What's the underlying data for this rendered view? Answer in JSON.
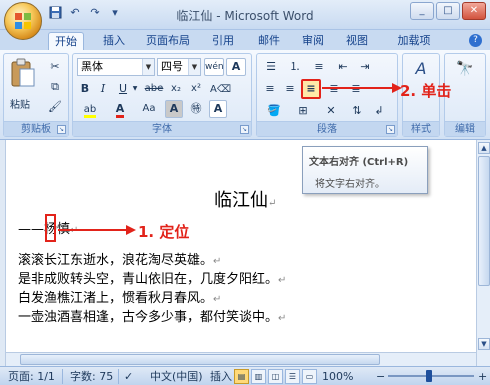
{
  "titlebar": {
    "title": "临江仙 - Microsoft Word",
    "qat": [
      "save-icon",
      "undo-icon",
      "redo-icon",
      "customize-icon"
    ],
    "window_buttons": [
      "_",
      "□",
      "✕"
    ]
  },
  "tabs": [
    {
      "label": "开始",
      "active": true
    },
    {
      "label": "插入"
    },
    {
      "label": "页面布局"
    },
    {
      "label": "引用"
    },
    {
      "label": "邮件"
    },
    {
      "label": "审阅"
    },
    {
      "label": "视图"
    },
    {
      "label": "加载项"
    }
  ],
  "ribbon": {
    "clipboard": {
      "label": "剪贴板",
      "paste_label": "粘贴"
    },
    "font": {
      "label": "字体",
      "font_name": "黑体",
      "font_size": "四号",
      "btn_wen": "wén",
      "btn_A": "A",
      "bold": "B",
      "italic": "I",
      "underline": "U",
      "strike": "abe",
      "sub": "x₂",
      "sup": "x²",
      "clear_format": "Aa",
      "font_color": "A",
      "highlight": "ab",
      "change_case": "Aa",
      "char_shading": "A",
      "char_border": "A",
      "enclose": "字",
      "grow": "A↑",
      "shrink": "A↓"
    },
    "paragraph": {
      "label": "段落"
    },
    "styles": {
      "label": "样式"
    },
    "editing": {
      "label": "编辑"
    }
  },
  "tooltip": {
    "title": "文本右对齐 (Ctrl+R)",
    "body": "将文字右对齐。"
  },
  "document": {
    "title": "临江仙",
    "author": "杨慎",
    "lines": [
      "滚滚长江东逝水，浪花淘尽英雄。",
      "是非成败转头空，青山依旧在，几度夕阳红。",
      "白发渔樵江渚上，惯看秋月春风。",
      "一壶浊酒喜相逢，古今多少事，都付笑谈中。"
    ],
    "para_mark": "↵"
  },
  "annotations": {
    "step1": "1. 定位",
    "step2": "2. 单击"
  },
  "statusbar": {
    "page": "页面: 1/1",
    "words": "字数: 75",
    "language": "中文(中国)",
    "insert": "插入",
    "zoom": "100%",
    "zoom_minus": "−",
    "zoom_plus": "+"
  },
  "colors": {
    "annotation_red": "#e2231a",
    "ribbon_blue": "#dfeaf8",
    "font_color_red": "#e2231a",
    "highlight_yellow": "#ffff00"
  }
}
